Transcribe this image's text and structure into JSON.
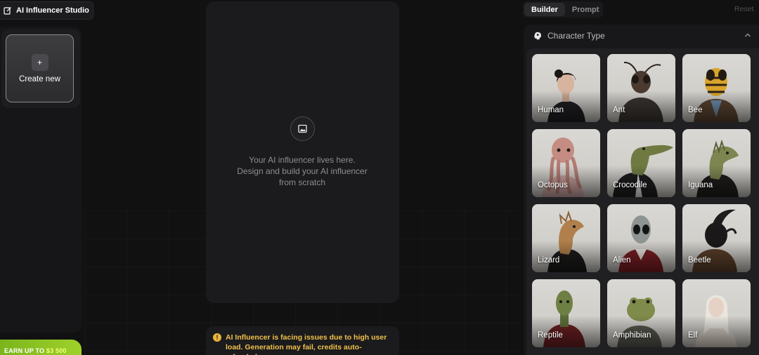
{
  "app": {
    "title": "AI Influencer Studio"
  },
  "sidebar": {
    "create_icon": "plus-icon",
    "create_label": "Create new",
    "earn_text": "EARN UP TO",
    "earn_amount": "$3 500"
  },
  "canvas": {
    "icon": "image-icon",
    "line1": "Your AI influencer lives here.",
    "line2": "Design and build your AI influencer",
    "line3": "from scratch"
  },
  "notice": {
    "icon": "warning-icon",
    "text": "AI Influencer is facing issues due to high user load. Generation may fail, credits auto-refunded."
  },
  "right_panel": {
    "tabs": [
      {
        "label": "Builder",
        "active": true
      },
      {
        "label": "Prompt",
        "active": false
      }
    ],
    "reset_label": "Reset",
    "section_title": "Character Type",
    "section_icon": "character-icon",
    "characters": [
      {
        "label": "Human"
      },
      {
        "label": "Ant"
      },
      {
        "label": "Bee"
      },
      {
        "label": "Octopus"
      },
      {
        "label": "Crocodile"
      },
      {
        "label": "Iguana"
      },
      {
        "label": "Lizard"
      },
      {
        "label": "Alien"
      },
      {
        "label": "Beetle"
      },
      {
        "label": "Reptile"
      },
      {
        "label": "Amphibian"
      },
      {
        "label": "Elf"
      }
    ]
  },
  "colors": {
    "accent_green": "#8cc322",
    "warning": "#f0c04a",
    "background": "#111112"
  }
}
